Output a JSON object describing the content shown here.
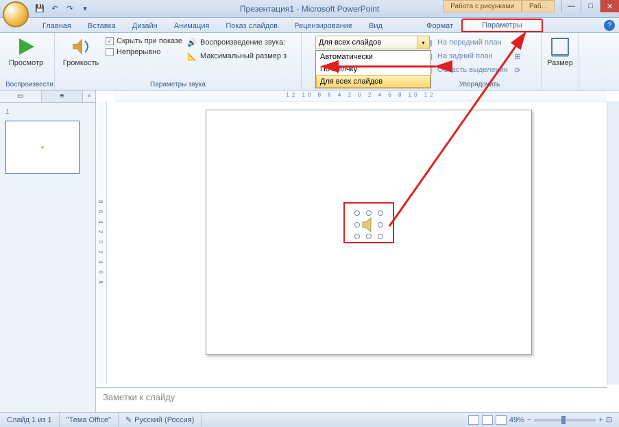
{
  "title": "Презентация1 - Microsoft PowerPoint",
  "contextual": {
    "tools": "Работа с рисунками",
    "tools2": "Раб..."
  },
  "tabs": {
    "home": "Главная",
    "insert": "Вставка",
    "design": "Дизайн",
    "anim": "Анимация",
    "show": "Показ слайдов",
    "review": "Рецензирование",
    "view": "Вид",
    "format": "Формат",
    "params": "Параметры"
  },
  "ribbon": {
    "preview": "Просмотр",
    "preview_group": "Воспроизвести",
    "volume": "Громкость",
    "hide": "Скрыть при показе",
    "loop": "Непрерывно",
    "playback": "Воспроизведение звука:",
    "maxsize": "Максимальный размер з",
    "sound_group": "Параметры звука",
    "dd_selected": "Для всех слайдов",
    "dd_items": {
      "auto": "Автоматически",
      "click": "По щелчку",
      "all": "Для всех слайдов"
    },
    "bring_front": "На передний план",
    "send_back": "На задний план",
    "selection_pane": "Область выделения",
    "arrange_group": "Упорядочить",
    "size": "Размер"
  },
  "notes_placeholder": "Заметки к слайду",
  "status": {
    "slide": "Слайд 1 из 1",
    "theme": "\"Тема Office\"",
    "lang": "Русский (Россия)",
    "zoom": "49%"
  },
  "ruler_h": "12 10 8 6 4 2 0 2 4 6 8 10 12",
  "ruler_v": "8 6 4 2 0 2 4 6 8",
  "thumb_num": "1"
}
